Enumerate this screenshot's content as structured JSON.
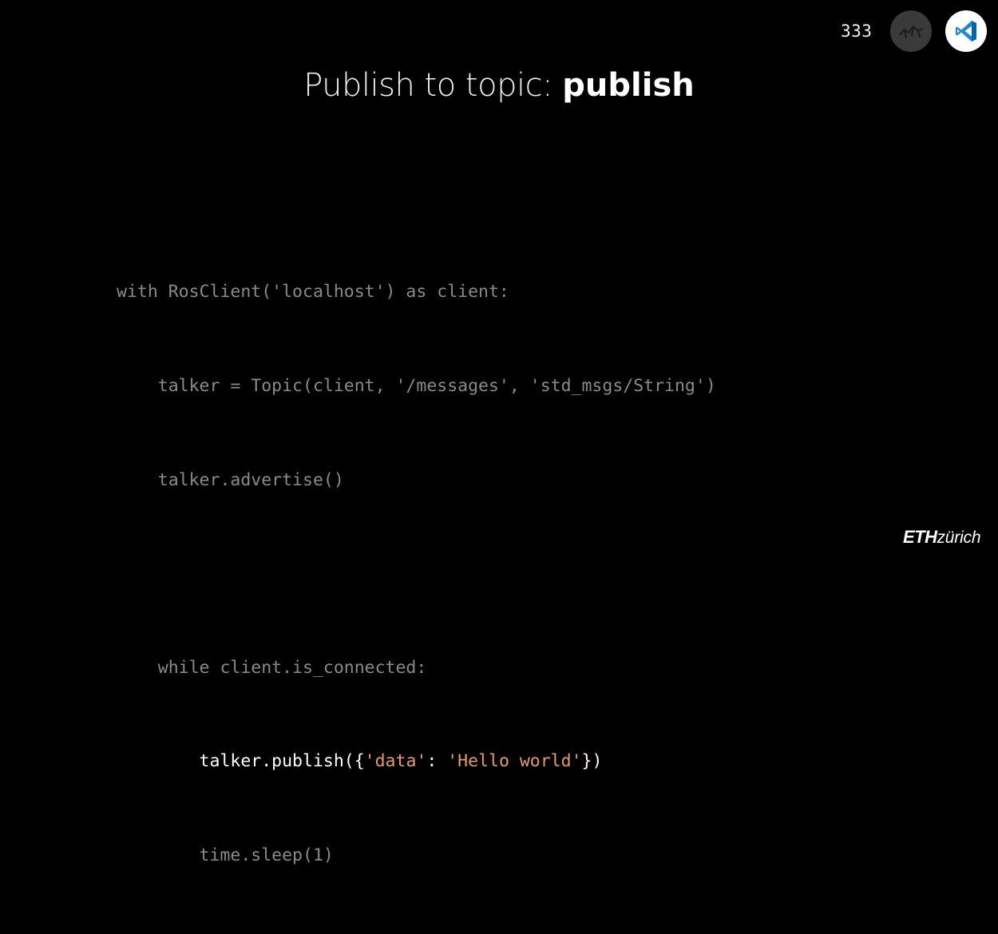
{
  "slide": {
    "page_number": "333",
    "title_light": "Publish to topic: ",
    "title_bold": "publish"
  },
  "icons": {
    "avatar": "ros-robot-icon",
    "editor": "vscode-icon",
    "avatar_bg": "#3a3a3a",
    "editor_accent": "#007acc"
  },
  "code": {
    "line1": "with RosClient('localhost') as client:",
    "line2": "    talker = Topic(client, '/messages', 'std_msgs/String')",
    "line3": "    talker.advertise()",
    "line4": "",
    "line5": "    while client.is_connected:",
    "line6_prefix": "        talker.publish({",
    "line6_key": "'data'",
    "line6_sep": ": ",
    "line6_value": "'Hello world'",
    "line6_suffix": "})",
    "line7": "        time.sleep(1)"
  },
  "colors": {
    "background": "#000000",
    "dim_code": "#8a8a8a",
    "highlight_code": "#ffffff",
    "string_literal": "#e59a72"
  },
  "footer": {
    "logo_eth": "ETH",
    "logo_zurich": "zürich"
  }
}
